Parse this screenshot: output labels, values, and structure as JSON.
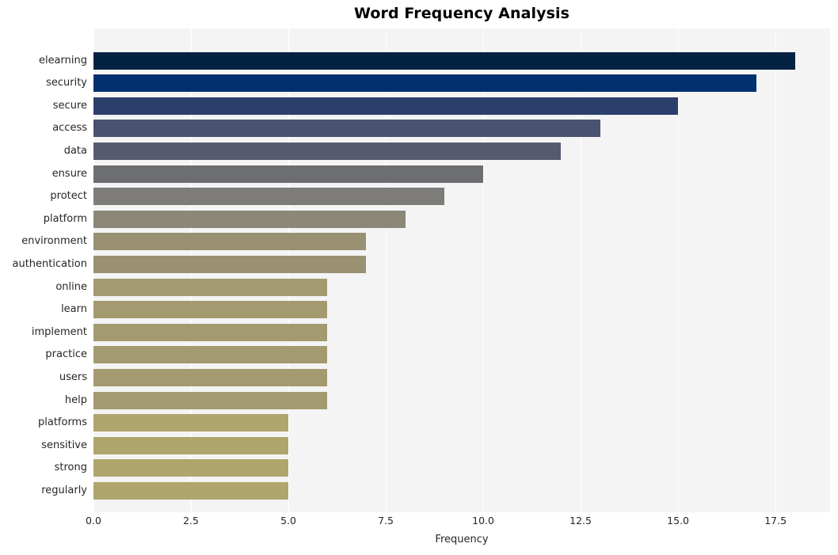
{
  "chart_data": {
    "type": "bar",
    "orientation": "horizontal",
    "title": "Word Frequency Analysis",
    "xlabel": "Frequency",
    "ylabel": "",
    "xlim": [
      0,
      18.9
    ],
    "xticks": [
      0.0,
      2.5,
      5.0,
      7.5,
      10.0,
      12.5,
      15.0,
      17.5
    ],
    "xtick_labels": [
      "0.0",
      "2.5",
      "5.0",
      "7.5",
      "10.0",
      "12.5",
      "15.0",
      "17.5"
    ],
    "grid": "vertical-only-white-on-gray",
    "legend": "none",
    "categories": [
      "elearning",
      "security",
      "secure",
      "access",
      "data",
      "ensure",
      "protect",
      "platform",
      "environment",
      "authentication",
      "online",
      "learn",
      "implement",
      "practice",
      "users",
      "help",
      "platforms",
      "sensitive",
      "strong",
      "regularly"
    ],
    "values": [
      18,
      17,
      15,
      13,
      12,
      10,
      9,
      8,
      7,
      7,
      6,
      6,
      6,
      6,
      6,
      6,
      5,
      5,
      5,
      5
    ],
    "bar_colors": [
      "#042343",
      "#00306f",
      "#2c3e6b",
      "#49536f",
      "#565a71",
      "#6c6e72",
      "#7d7c78",
      "#8b8878",
      "#999072",
      "#9a9172",
      "#a39a6f",
      "#a39a6f",
      "#a39a6f",
      "#a39a6f",
      "#a39a6f",
      "#a39a6f",
      "#b0a56c",
      "#b0a56c",
      "#b0a56c",
      "#b0a56c"
    ],
    "colormap": "cividis",
    "plot_background": "#f4f4f5",
    "figure_background": "#ffffff",
    "gridline_color": "#ffffff",
    "text_color": "#262626",
    "title_color": "#000000"
  }
}
